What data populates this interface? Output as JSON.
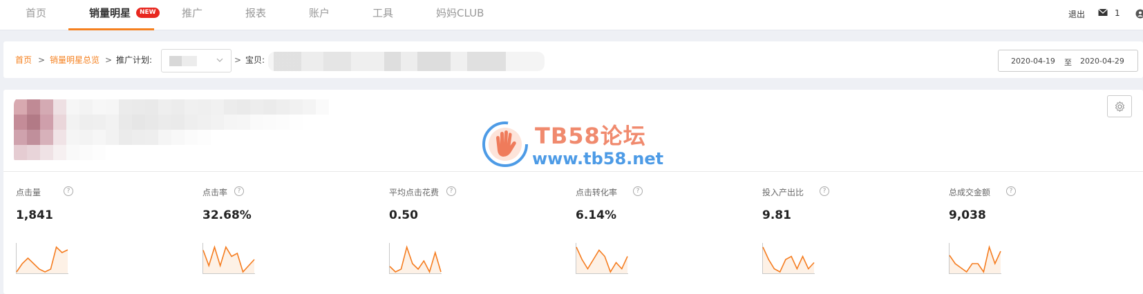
{
  "nav": {
    "items": [
      {
        "label": "首页"
      },
      {
        "label": "销量明星",
        "badge": "NEW"
      },
      {
        "label": "推广"
      },
      {
        "label": "报表"
      },
      {
        "label": "账户"
      },
      {
        "label": "工具"
      },
      {
        "label": "妈妈CLUB"
      }
    ],
    "logout": "退出",
    "mail_count": "1"
  },
  "breadcrumb": {
    "home": "首页",
    "overview": "销量明星总览",
    "plan_label": "推广计划:",
    "item_label": "宝贝:",
    "sep": ">"
  },
  "date_range": {
    "start": "2020-04-19",
    "to": "至",
    "end": "2020-04-29"
  },
  "watermark": {
    "title": "TB58论坛",
    "url": "www.tb58.net"
  },
  "metrics": [
    {
      "label": "点击量",
      "value": "1,841",
      "trend": [
        2,
        5,
        7,
        5,
        3,
        2,
        3,
        11,
        9,
        10
      ]
    },
    {
      "label": "点击率",
      "value": "32.68%",
      "trend": [
        8,
        3,
        9,
        3,
        9,
        6,
        7,
        1,
        3,
        5
      ]
    },
    {
      "label": "平均点击花费",
      "value": "0.50",
      "trend": [
        3,
        1,
        2,
        10,
        4,
        2,
        5,
        1,
        8,
        1
      ]
    },
    {
      "label": "点击转化率",
      "value": "6.14%",
      "trend": [
        9,
        5,
        2,
        5,
        8,
        6,
        1,
        4,
        2,
        6
      ]
    },
    {
      "label": "投入产出比",
      "value": "9.81",
      "trend": [
        9,
        5,
        2,
        1,
        5,
        6,
        2,
        6,
        2,
        4
      ]
    },
    {
      "label": "总成交金额",
      "value": "9,038",
      "trend": [
        7,
        5,
        4,
        3,
        5,
        5,
        3,
        9,
        5,
        8
      ]
    }
  ],
  "colors": {
    "accent": "#f5801f",
    "spark_line": "#f57c1f",
    "badge": "#e8271f"
  }
}
